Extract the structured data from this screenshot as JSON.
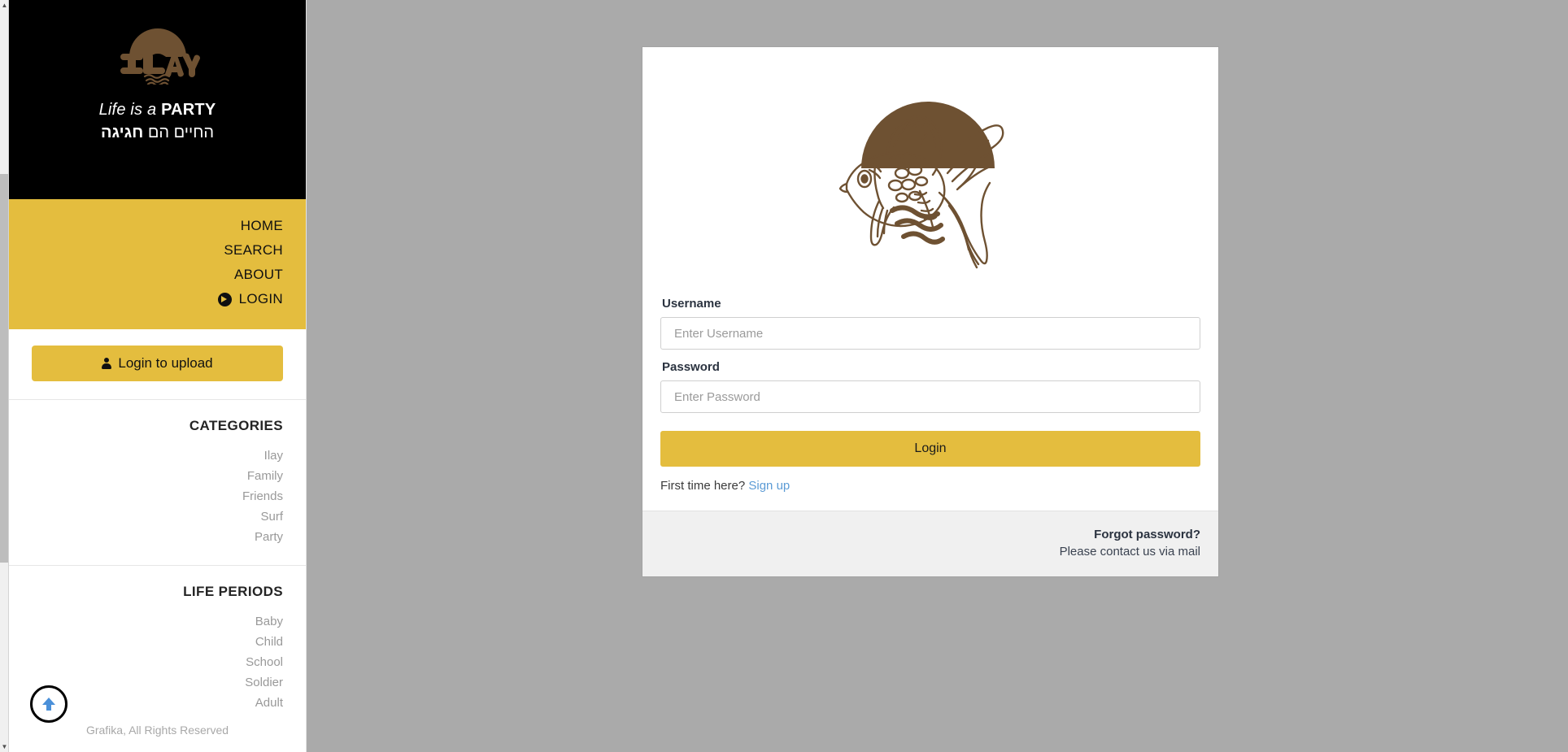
{
  "brand": {
    "logo_text": "ILAY",
    "logo_icon": "ilay-sun-waves-logo",
    "tagline_en_prefix": "Life is a ",
    "tagline_en_bold": "PARTY",
    "tagline_he_prefix": "החיים הם ",
    "tagline_he_bold": "חגיגה"
  },
  "nav": {
    "items": [
      {
        "label": "HOME",
        "icon": null
      },
      {
        "label": "SEARCH",
        "icon": null
      },
      {
        "label": "ABOUT",
        "icon": null
      },
      {
        "label": "LOGIN",
        "icon": "arrow-circle-right-icon"
      }
    ]
  },
  "upload": {
    "label": "Login to upload",
    "icon": "user-icon"
  },
  "categories": {
    "title": "CATEGORIES",
    "items": [
      "Ilay",
      "Family",
      "Friends",
      "Surf",
      "Party"
    ]
  },
  "life_periods": {
    "title": "LIFE PERIODS",
    "items": [
      "Baby",
      "Child",
      "School",
      "Soldier",
      "Adult"
    ]
  },
  "footer": {
    "copyright": "Grafika, All Rights Reserved"
  },
  "back_to_top": {
    "icon": "arrow-up-icon"
  },
  "login_card": {
    "header_icon": "goldfish-sun-illustration",
    "username": {
      "label": "Username",
      "placeholder": "Enter Username",
      "value": ""
    },
    "password": {
      "label": "Password",
      "placeholder": "Enter Password",
      "value": ""
    },
    "submit_label": "Login",
    "signup_prompt": "First time here?",
    "signup_link": "Sign up",
    "forgot_title": "Forgot password?",
    "forgot_sub": "Please contact us via mail"
  },
  "colors": {
    "accent_yellow": "#e4bd3e",
    "brand_brown": "#6e5132",
    "page_bg": "#aaaaaa",
    "link_blue": "#5b9bd5"
  },
  "scrollbar": {
    "up_arrow": "▲",
    "down_arrow": "▼"
  }
}
